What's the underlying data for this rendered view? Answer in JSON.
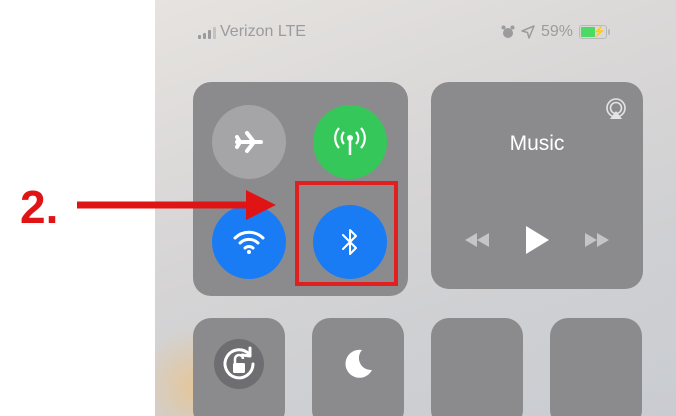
{
  "status_bar": {
    "carrier": "Verizon LTE",
    "battery_percent": "59%",
    "battery_level": 0.59,
    "icons": [
      "signal-bars-icon",
      "alarm-icon",
      "location-arrow-icon",
      "battery-charging-icon"
    ]
  },
  "connectivity": {
    "airplane_mode": {
      "icon": "airplane-icon",
      "state": "off"
    },
    "cellular_data": {
      "icon": "cellular-antenna-icon",
      "state": "on"
    },
    "wifi": {
      "icon": "wifi-icon",
      "state": "on"
    },
    "bluetooth": {
      "icon": "bluetooth-icon",
      "state": "on"
    }
  },
  "music": {
    "title": "Music",
    "airplay_icon": "airplay-icon",
    "controls": [
      "rewind-icon",
      "play-icon",
      "fast-forward-icon"
    ]
  },
  "bottom_tiles": [
    {
      "icon": "orientation-lock-icon"
    },
    {
      "icon": "moon-icon"
    },
    {
      "icon": ""
    },
    {
      "icon": ""
    }
  ],
  "annotation": {
    "step_label": "2.",
    "color": "#e01414"
  },
  "colors": {
    "green": "#35c759",
    "blue": "#1a7cf5",
    "tile_gray": "#8b8b8e"
  }
}
